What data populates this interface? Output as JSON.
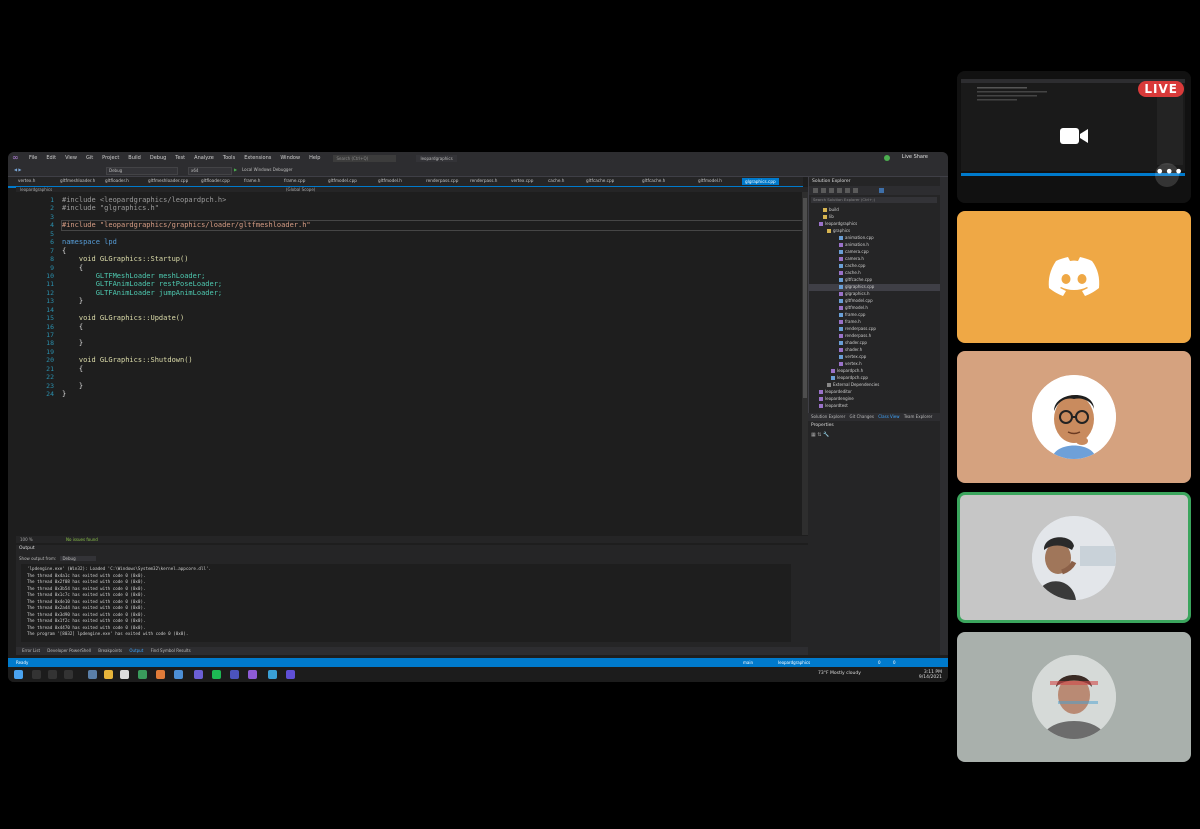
{
  "call": {
    "live_badge": "LIVE",
    "more_label": "•••",
    "participants": [
      "screen-share",
      "discord",
      "avatar-1",
      "avatar-2",
      "avatar-3"
    ]
  },
  "menu": [
    "File",
    "Edit",
    "View",
    "Git",
    "Project",
    "Build",
    "Debug",
    "Test",
    "Analyze",
    "Tools",
    "Extensions",
    "Window",
    "Help"
  ],
  "search_placeholder": "Search (Ctrl+Q)",
  "solution_name": "leopardgraphics",
  "live_share": "Live Share",
  "toolbar": {
    "config": "Debug",
    "platform": "x64",
    "run_target": "Local Windows Debugger"
  },
  "tabs": [
    "vertex.h",
    "gltfmeshloader.h",
    "gltfloader.h",
    "gltfmeshloader.cpp",
    "gltfloader.cpp",
    "frame.h",
    "frame.cpp",
    "gltfmodel.cpp",
    "gltfmodel.h",
    "renderpass.cpp",
    "renderpass.h",
    "vertex.cpp",
    "cache.h",
    "gltfcache.cpp",
    "gltfcache.h",
    "gltfmodel.h",
    "glgraphics.cpp"
  ],
  "active_tab": "glgraphics.cpp",
  "nav": {
    "project": "leopardgraphics",
    "scope": "(Global Scope)"
  },
  "code": {
    "line_numbers": [
      "1",
      "2",
      "3",
      "4",
      "5",
      "6",
      "7",
      "8",
      "9",
      "10",
      "11",
      "12",
      "13",
      "14",
      "15",
      "16",
      "17",
      "18",
      "19",
      "20",
      "21",
      "22",
      "23",
      "24"
    ],
    "lines": [
      "#include <leopardgraphics/leopardpch.h>",
      "#include \"glgraphics.h\"",
      "",
      "#include \"leopardgraphics/graphics/loader/gltfmeshloader.h\"",
      "",
      "namespace lpd",
      "{",
      "    void GLGraphics::Startup()",
      "    {",
      "        GLTFMeshLoader meshLoader;",
      "        GLTFAnimLoader restPoseLoader;",
      "        GLTFAnimLoader jumpAnimLoader;",
      "    }",
      "",
      "    void GLGraphics::Update()",
      "    {",
      "",
      "    }",
      "",
      "    void GLGraphics::Shutdown()",
      "    {",
      "",
      "    }",
      "}"
    ]
  },
  "editor_status": {
    "zoom": "100 %",
    "issues": "No issues found"
  },
  "output": {
    "title": "Output",
    "source_label": "Show output from:",
    "source_value": "Debug",
    "lines": [
      "'lpdengine.exe' (Win32): Loaded 'C:\\Windows\\System32\\kernel.appcore.dll'.",
      "The thread 0x4a1c has exited with code 0 (0x0).",
      "The thread 0x2f08 has exited with code 0 (0x0).",
      "The thread 0x3b54 has exited with code 0 (0x0).",
      "The thread 0x1c7c has exited with code 0 (0x0).",
      "The thread 0x4e10 has exited with code 0 (0x0).",
      "The thread 0x2a44 has exited with code 0 (0x0).",
      "The thread 0x3d90 has exited with code 0 (0x0).",
      "The thread 0x1f2c has exited with code 0 (0x0).",
      "The thread 0x4470 has exited with code 0 (0x0).",
      "The program '[8032] lpdengine.exe' has exited with code 0 (0x0)."
    ]
  },
  "output_tabs": [
    "Error List",
    "Developer PowerShell",
    "Breakpoints",
    "Output",
    "Find Symbol Results"
  ],
  "solution_explorer": {
    "title": "Solution Explorer",
    "search_placeholder": "Search Solution Explorer (Ctrl+;)",
    "items": [
      "build",
      "lib",
      "leopardgraphics",
      "graphics",
      "animation.cpp",
      "animation.h",
      "camera.cpp",
      "camera.h",
      "cache.cpp",
      "cache.h",
      "gltfcache.cpp",
      "glgraphics.cpp",
      "glgraphics.h",
      "gltfmodel.cpp",
      "gltfmodel.h",
      "frame.cpp",
      "frame.h",
      "renderpass.cpp",
      "renderpass.h",
      "shader.cpp",
      "shader.h",
      "vertex.cpp",
      "vertex.h",
      "leopardpch.h",
      "leopardpch.cpp",
      "External Dependencies",
      "leopardeditor",
      "leopardengine",
      "leopardtest"
    ],
    "selected_index": 11,
    "tabs": [
      "Solution Explorer",
      "Git Changes",
      "Class View",
      "Team Explorer"
    ],
    "active_tab_index": 0
  },
  "properties": {
    "title": "Properties"
  },
  "statusbar": {
    "left": "Ready",
    "branch": "main",
    "repo": "leopardgraphics",
    "errors": "0",
    "warnings": "0"
  },
  "taskbar": {
    "weather": "73°F Mostly cloudy",
    "time": "3:11 PM",
    "date": "9/14/2021"
  },
  "colors": {
    "accent": "#007acc",
    "live": "#d93a3a",
    "discord_tile": "#efa845",
    "speaking_border": "#3ba55d"
  }
}
